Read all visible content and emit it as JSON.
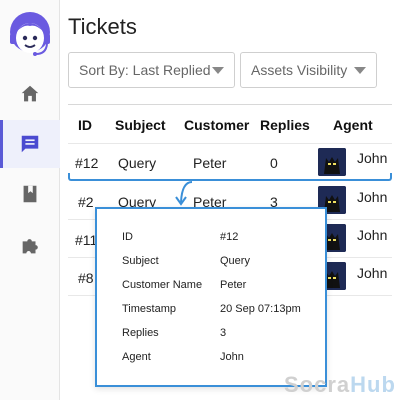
{
  "page": {
    "title": "Tickets"
  },
  "filters": {
    "sort_label": "Sort By: Last Replied",
    "assets_label": "Assets Visibility"
  },
  "sidebar": {
    "items": [
      {
        "name": "home",
        "icon": "home-icon",
        "active": false
      },
      {
        "name": "tickets",
        "icon": "chat-icon",
        "active": true
      },
      {
        "name": "knowledge-base",
        "icon": "book-icon",
        "active": false
      },
      {
        "name": "integrations",
        "icon": "puzzle-icon",
        "active": false
      }
    ]
  },
  "table": {
    "columns": [
      "ID",
      "Subject",
      "Customer",
      "Replies",
      "Agent"
    ],
    "rows": [
      {
        "id": "#12",
        "subject": "Query",
        "customer": "Peter",
        "replies": "0",
        "agent": "John"
      },
      {
        "id": "#2",
        "subject": "Query",
        "customer": "Peter",
        "replies": "3",
        "agent": "John"
      },
      {
        "id": "#11",
        "subject": "",
        "customer": "",
        "replies": "",
        "agent": "John"
      },
      {
        "id": "#8",
        "subject": "",
        "customer": "",
        "replies": "",
        "agent": "John"
      }
    ]
  },
  "detail": {
    "fields": [
      {
        "key": "ID",
        "value": "#12"
      },
      {
        "key": "Subject",
        "value": "Query"
      },
      {
        "key": "Customer Name",
        "value": "Peter"
      },
      {
        "key": "Timestamp",
        "value": "20 Sep 07:13pm"
      },
      {
        "key": "Replies",
        "value": "3"
      },
      {
        "key": "Agent",
        "value": "John"
      }
    ]
  },
  "watermark": {
    "part1": "Socra",
    "part2": "Hub"
  },
  "colors": {
    "accent": "#5a5ad6",
    "highlight": "#3a8fd8",
    "avatar_bg": "#1e2a55"
  }
}
